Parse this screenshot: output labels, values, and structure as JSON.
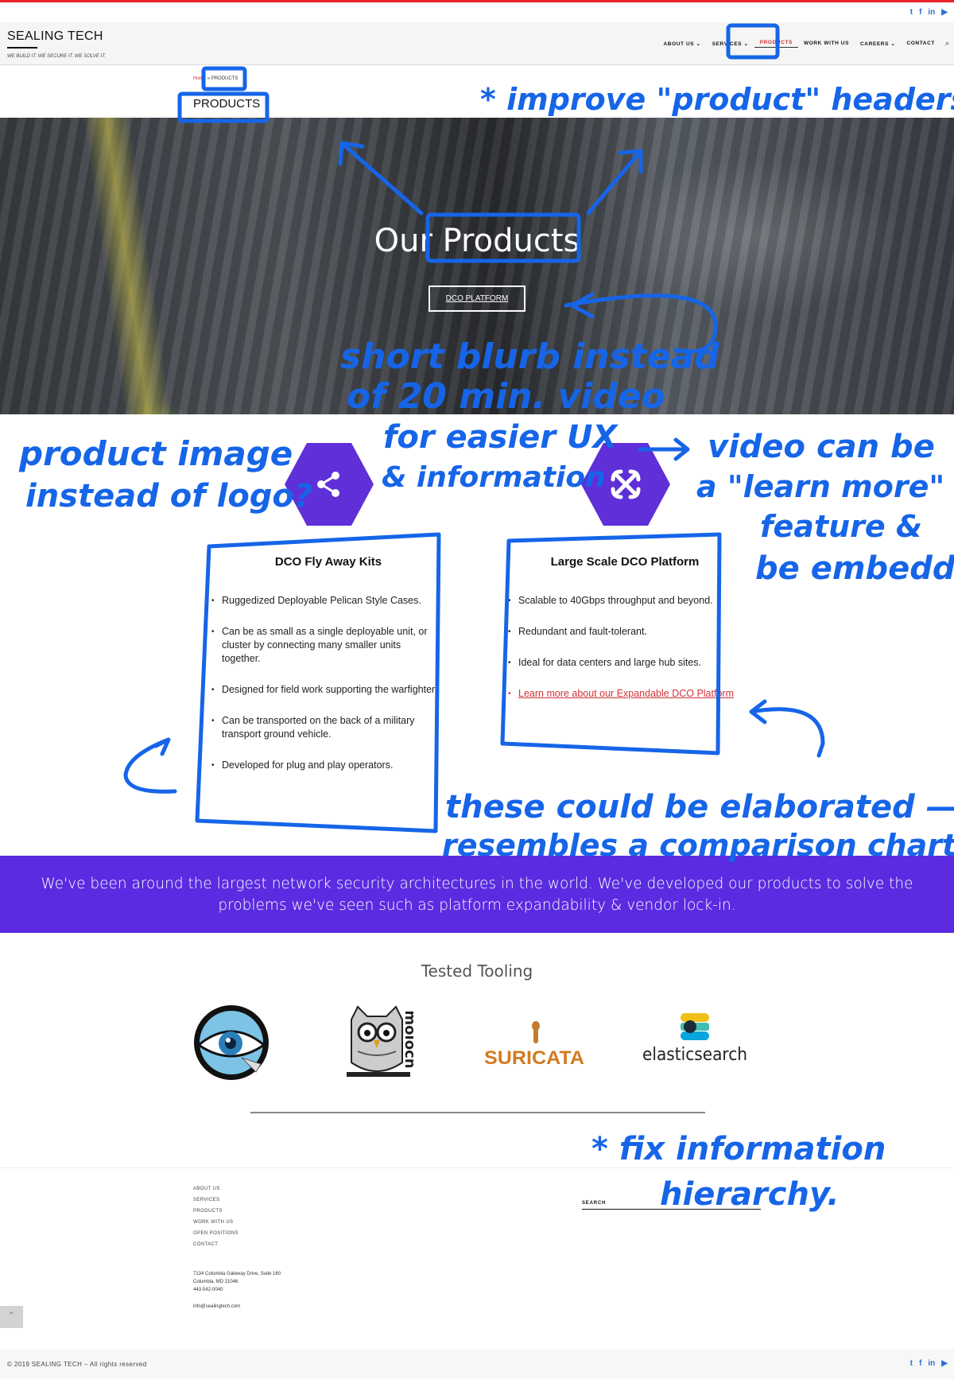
{
  "site": {
    "brand": "SEALING TECH",
    "tagline": "WE BUILD IT. WE SECURE IT. WE SOLVE IT.",
    "social_icons": [
      "twitter-icon",
      "facebook-icon",
      "linkedin-icon",
      "youtube-icon"
    ],
    "social_glyphs": [
      "t",
      "f",
      "in",
      "▶"
    ]
  },
  "nav": {
    "items": [
      "ABOUT US ⌄",
      "SERVICES ⌄",
      "PRODUCTS",
      "WORK WITH US",
      "CAREERS ⌄",
      "CONTACT"
    ],
    "active": "PRODUCTS",
    "search_icon": "⌕"
  },
  "breadcrumb": {
    "home": "Home",
    "separator": "»",
    "current": "PRODUCTS"
  },
  "page_title": "PRODUCTS",
  "hero": {
    "title": "Our Products",
    "button": "DCO PLATFORM"
  },
  "products": [
    {
      "icon": "share-icon",
      "title": "DCO Fly Away Kits",
      "bullets": [
        "Ruggedized Deployable Pelican Style Cases.",
        "Can be as small as a single deployable unit, or cluster by connecting many smaller units together.",
        "Designed for field work supporting the warfighter.",
        "Can be transported on the back of a military transport ground vehicle.",
        "Developed for plug and play operators."
      ]
    },
    {
      "icon": "joomla-icon",
      "title": "Large Scale DCO Platform",
      "bullets": [
        "Scalable to 40Gbps throughput and beyond.",
        "Redundant and fault-tolerant.",
        "Ideal for data centers and large hub sites."
      ],
      "link": "Learn more about our Expandable DCO Platform"
    }
  ],
  "banner": "We've been around the largest network security architectures in the world. We've developed our products to solve the problems we've seen such as platform expandability & vendor lock-in.",
  "tooling": {
    "title": "Tested Tooling",
    "logos": [
      {
        "name": "eye-logo",
        "label": ""
      },
      {
        "name": "owl-logo",
        "label": "moloch"
      },
      {
        "name": "suricata-logo",
        "label": "SURICATA"
      },
      {
        "name": "elasticsearch-logo",
        "label": "elasticsearch"
      }
    ]
  },
  "footer": {
    "links": [
      "ABOUT US",
      "SERVICES",
      "PRODUCTS",
      "WORK WITH US",
      "OPEN POSITIONS",
      "CONTACT"
    ],
    "address": [
      "7134 Columbia Gateway Drive, Suite 160",
      "Columbia, MD 21046",
      "443-542-0040"
    ],
    "email": "info@sealingtech.com",
    "search_label": "SEARCH",
    "back_to_top": "⌃",
    "copyright": "© 2019 SEALING TECH – All rights reserved"
  },
  "annotations": {
    "headers": "* improve \"product\" headers",
    "blurb_1": "short blurb instead",
    "blurb_2": "of 20 min. video",
    "blurb_3": "for easier UX",
    "blurb_4": "& information",
    "image_1": "product image",
    "image_2": "instead of logo?",
    "video_1": "video can be",
    "video_2": "a \"learn more\"",
    "video_3": "feature &",
    "video_4": "be embedded.",
    "compare_1": "these could be elaborated —",
    "compare_2": "resembles a comparison chart.",
    "hierarchy_1": "* fix information",
    "hierarchy_2": "hierarchy."
  },
  "colors": {
    "accent_red": "#e3232b",
    "purple": "#5a2be0",
    "annotation_blue": "#1665e8"
  }
}
